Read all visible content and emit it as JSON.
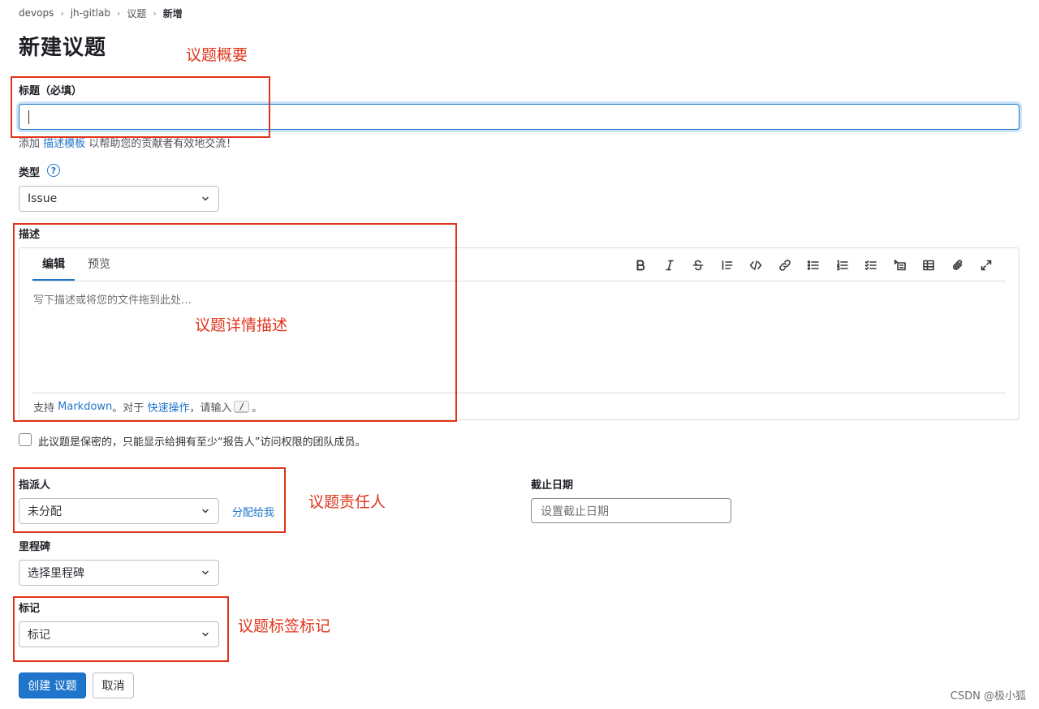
{
  "breadcrumb": [
    "devops",
    "jh-gitlab",
    "议题",
    "新增"
  ],
  "page_title": "新建议题",
  "title_field": {
    "label": "标题（必填）",
    "value": ""
  },
  "template_help": {
    "prefix": "添加",
    "link": "描述模板",
    "suffix": "以帮助您的贡献者有效地交流！"
  },
  "type_field": {
    "label": "类型",
    "help_icon": "question-circle-icon",
    "value": "Issue"
  },
  "description": {
    "label": "描述",
    "tabs": [
      "编辑",
      "预览"
    ],
    "active_tab": "编辑",
    "placeholder": "写下描述或将您的文件拖到此处…",
    "footer": {
      "support": "支持",
      "markdown_link": "Markdown",
      "for_text": "。对于",
      "quick_actions_link": "快速操作",
      "input_text": "，请输入",
      "key": "/",
      "end": "。"
    },
    "toolbar_icons": [
      "bold-icon",
      "italic-icon",
      "strikethrough-icon",
      "quote-icon",
      "code-icon",
      "link-icon",
      "bullet-list-icon",
      "numbered-list-icon",
      "task-list-icon",
      "collapsible-icon",
      "table-icon",
      "attachment-icon",
      "fullscreen-icon"
    ]
  },
  "confidential": {
    "label": "此议题是保密的，只能显示给拥有至少“报告人”访问权限的团队成员。",
    "checked": false
  },
  "assignee": {
    "label": "指派人",
    "value": "未分配",
    "assign_me": "分配给我"
  },
  "due_date": {
    "label": "截止日期",
    "placeholder": "设置截止日期"
  },
  "milestone": {
    "label": "里程碑",
    "value": "选择里程碑"
  },
  "labels": {
    "label": "标记",
    "value": "标记"
  },
  "buttons": {
    "create": "创建 议题",
    "cancel": "取消"
  },
  "annotations": {
    "summary": "议题概要",
    "detail": "议题详情描述",
    "owner": "议题责任人",
    "tags": "议题标签标记",
    "color": "#e0351c"
  },
  "watermark": "CSDN @极小狐",
  "colors": {
    "primary": "#1f75cb",
    "text": "#333238"
  }
}
